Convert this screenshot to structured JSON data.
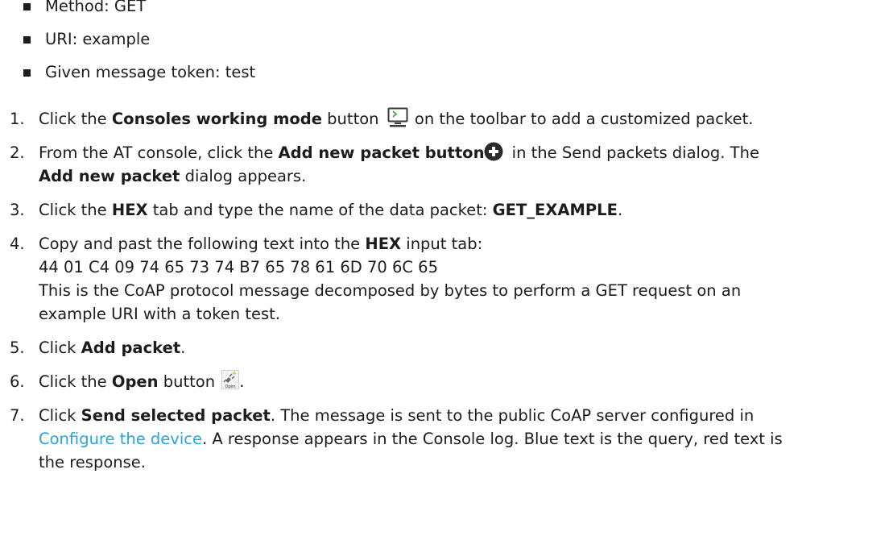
{
  "bullets": [
    "Method: GET",
    "URI: example",
    "Given message token: test"
  ],
  "step1": {
    "num": "1.",
    "pre": "Click the ",
    "bold": "Consoles working mode",
    "mid": " button ",
    "post": " on the toolbar to add a customized packet.",
    "icon": "console-icon"
  },
  "step2": {
    "num": "2.",
    "pre": "From the AT console, click the ",
    "bold": "Add new packet button",
    "post": " in the Send packets dialog. The ",
    "bold2": "Add new packet",
    "post2": " dialog appears.",
    "icon": "add-circle-icon"
  },
  "step3": {
    "num": "3.",
    "pre": "Click the ",
    "bold": "HEX",
    "mid": " tab and type the name of the data packet: ",
    "bold2": "GET_EXAMPLE",
    "post": "."
  },
  "step4": {
    "num": "4.",
    "pre": "Copy and past the following text into the ",
    "bold": "HEX",
    "post": " input tab:",
    "hex": "44 01 C4 09 74 65 73 74 B7 65 78 61 6D 70 6C 65",
    "note1": "This is the CoAP protocol message decomposed by bytes to perform a GET request on an",
    "note2": "example URI with a token test."
  },
  "step5": {
    "num": "5.",
    "pre": "Click ",
    "bold": "Add packet",
    "post": "."
  },
  "step6": {
    "num": "6.",
    "pre": "Click the ",
    "bold": "Open",
    "mid": " button ",
    "post": ".",
    "icon": "open-plug-icon",
    "icon_label": "Open"
  },
  "step7": {
    "num": "7.",
    "pre": "Click ",
    "bold": "Send selected packet",
    "mid": ". The message is sent to the public CoAP server configured in",
    "link": "Configure the device",
    "post": ". A response appears in the Console log. Blue text is the query, red text is",
    "post2": "the response."
  },
  "colors": {
    "link": "#2aa3dc",
    "text": "#1c1c1c"
  }
}
